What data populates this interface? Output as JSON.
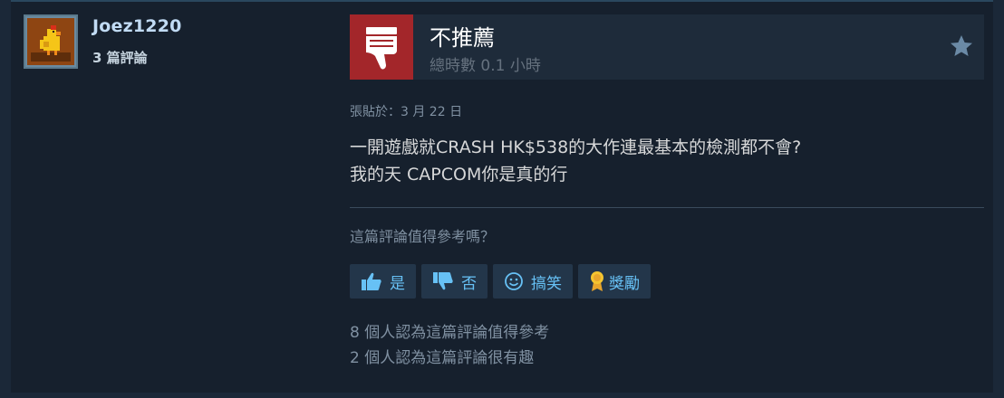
{
  "author": {
    "name": "Joez1220",
    "review_count": "3 篇評論",
    "avatar": "chicken-avatar"
  },
  "review": {
    "verdict": "不推薦",
    "hours": "總時數 0.1 小時",
    "posted": "張貼於：3 月 22 日",
    "body_lines": [
      "一開遊戲就CRASH HK$538的大作連最基本的檢測都不會?",
      "我的天 CAPCOM你是真的行"
    ],
    "thumb_icon": "thumbs-down-icon",
    "thumb_color": "#a3262a"
  },
  "helpful": {
    "question": "這篇評論值得參考嗎？",
    "buttons": {
      "yes": "是",
      "no": "否",
      "funny": "搞笑",
      "award": "獎勵"
    },
    "stats": [
      "8 個人認為這篇評論值得參考",
      "2 個人認為這篇評論很有趣"
    ]
  },
  "colors": {
    "background": "#1b2838",
    "card": "#16202d",
    "link": "#67c1f5",
    "author": "#c1dbf4"
  }
}
